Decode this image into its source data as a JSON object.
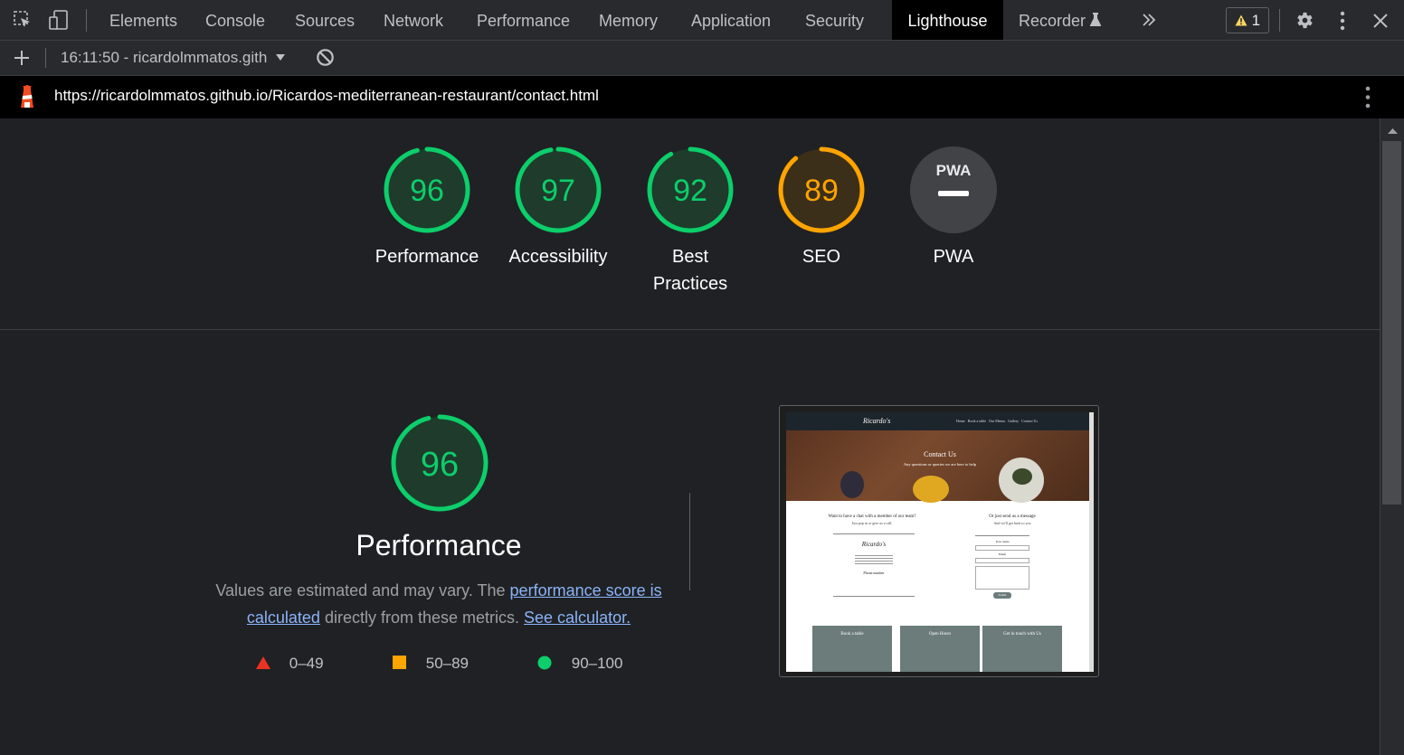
{
  "toolbar": {
    "tabs": [
      "Elements",
      "Console",
      "Sources",
      "Network",
      "Performance",
      "Memory",
      "Application",
      "Security",
      "Lighthouse",
      "Recorder"
    ],
    "active_tab": "Lighthouse",
    "warning_count": "1",
    "more_tabs_icon": "chevron-double-right-icon"
  },
  "report_bar": {
    "add_icon": "plus-icon",
    "report_select": "16:11:50 - ricardolmmatos.gith",
    "clear_icon": "block-icon"
  },
  "url_bar": {
    "url": "https://ricardolmmatos.github.io/Ricardos-mediterranean-restaurant/contact.html"
  },
  "scores": [
    {
      "label": "Performance",
      "value": "96",
      "status": "pass"
    },
    {
      "label": "Accessibility",
      "value": "97",
      "status": "pass"
    },
    {
      "label": "Best Practices",
      "value": "92",
      "status": "pass"
    },
    {
      "label": "SEO",
      "value": "89",
      "status": "average"
    },
    {
      "label": "PWA",
      "value": "PWA",
      "status": "na"
    }
  ],
  "performance": {
    "score": "96",
    "title": "Performance",
    "desc_prefix": "Values are estimated and may vary. The ",
    "desc_link1": "performance score is calculated",
    "desc_mid": " directly from these metrics. ",
    "desc_link2": "See calculator.",
    "legend": [
      {
        "range": "0–49",
        "shape": "triangle",
        "color": "#ea3323"
      },
      {
        "range": "50–89",
        "shape": "square",
        "color": "#ffa400"
      },
      {
        "range": "90–100",
        "shape": "circle",
        "color": "#0cce6b"
      }
    ]
  },
  "screenshot": {
    "brand": "Ricardo's",
    "nav": [
      "Home",
      "Book a table",
      "Our Menus",
      "Gallery",
      "Contact Us"
    ],
    "hero_title": "Contact Us",
    "hero_sub": "Any questions or queries we are here to help",
    "left_heading": "Want to have a chat with a member of our team?",
    "left_sub": "Just pop in or give us a call.",
    "phone_label": "Phone number",
    "right_heading": "Or just send us a message",
    "right_sub": "And we'll get back to you",
    "name_label": "Your name",
    "email_label": "Email",
    "submit": "Submit",
    "cards": [
      "Book a table",
      "Open Hours",
      "Get in touch with Us"
    ]
  },
  "colors": {
    "pass": "#0cce6b",
    "average": "#ffa400",
    "fail": "#ea3323",
    "link": "#8ab4f8"
  }
}
